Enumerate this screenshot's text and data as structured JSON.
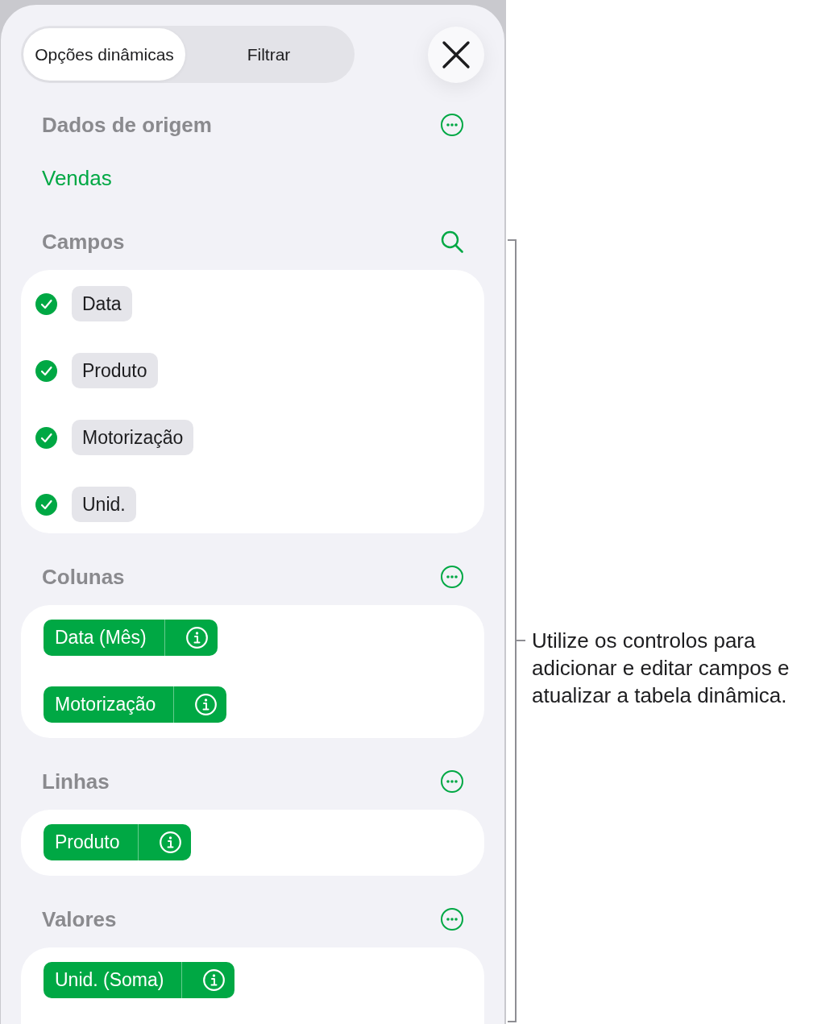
{
  "tabs": [
    {
      "label": "Opções dinâmicas",
      "selected": true
    },
    {
      "label": "Filtrar",
      "selected": false
    }
  ],
  "sections": [
    {
      "kind": "source",
      "title": "Dados de origem",
      "value": "Vendas"
    },
    {
      "kind": "fields",
      "title": "Campos",
      "items": [
        {
          "label": "Data",
          "checked": true
        },
        {
          "label": "Produto",
          "checked": true
        },
        {
          "label": "Motorização",
          "checked": true
        },
        {
          "label": "Unid.",
          "checked": true
        }
      ]
    },
    {
      "kind": "chips",
      "title": "Colunas",
      "items": [
        "Data (Mês)",
        "Motorização"
      ]
    },
    {
      "kind": "chips",
      "title": "Linhas",
      "items": [
        "Produto"
      ]
    },
    {
      "kind": "chips",
      "title": "Valores",
      "items": [
        "Unid. (Soma)"
      ]
    }
  ],
  "callout": "Utilize os controlos para adicionar e editar campos e atualizar a tabela dinâmica."
}
